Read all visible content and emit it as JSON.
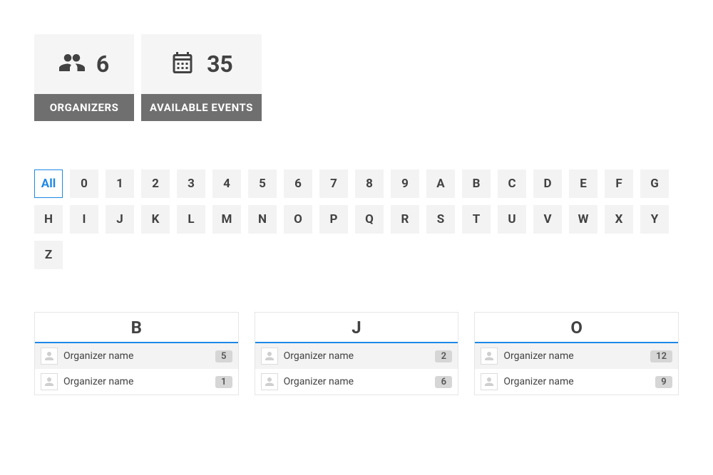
{
  "stats": [
    {
      "icon": "users-icon",
      "value": "6",
      "label": "ORGANIZERS"
    },
    {
      "icon": "calendar-icon",
      "value": "35",
      "label": "AVAILABLE EVENTS"
    }
  ],
  "filters": [
    {
      "label": "All",
      "active": true
    },
    {
      "label": "0"
    },
    {
      "label": "1"
    },
    {
      "label": "2"
    },
    {
      "label": "3"
    },
    {
      "label": "4"
    },
    {
      "label": "5"
    },
    {
      "label": "6"
    },
    {
      "label": "7"
    },
    {
      "label": "8"
    },
    {
      "label": "9"
    },
    {
      "label": "A"
    },
    {
      "label": "B"
    },
    {
      "label": "C"
    },
    {
      "label": "D"
    },
    {
      "label": "E"
    },
    {
      "label": "F"
    },
    {
      "label": "G"
    },
    {
      "label": "H"
    },
    {
      "label": "I"
    },
    {
      "label": "J"
    },
    {
      "label": "K"
    },
    {
      "label": "L"
    },
    {
      "label": "M"
    },
    {
      "label": "N"
    },
    {
      "label": "O"
    },
    {
      "label": "P"
    },
    {
      "label": "Q"
    },
    {
      "label": "R"
    },
    {
      "label": "S"
    },
    {
      "label": "T"
    },
    {
      "label": "U"
    },
    {
      "label": "V"
    },
    {
      "label": "W"
    },
    {
      "label": "X"
    },
    {
      "label": "Y"
    },
    {
      "label": "Z"
    }
  ],
  "groups": [
    {
      "letter": "B",
      "items": [
        {
          "name": "Organizer name",
          "count": "5"
        },
        {
          "name": "Organizer name",
          "count": "1"
        }
      ]
    },
    {
      "letter": "J",
      "items": [
        {
          "name": "Organizer name",
          "count": "2"
        },
        {
          "name": "Organizer name",
          "count": "6"
        }
      ]
    },
    {
      "letter": "O",
      "items": [
        {
          "name": "Organizer name",
          "count": "12"
        },
        {
          "name": "Organizer name",
          "count": "9"
        }
      ]
    }
  ]
}
